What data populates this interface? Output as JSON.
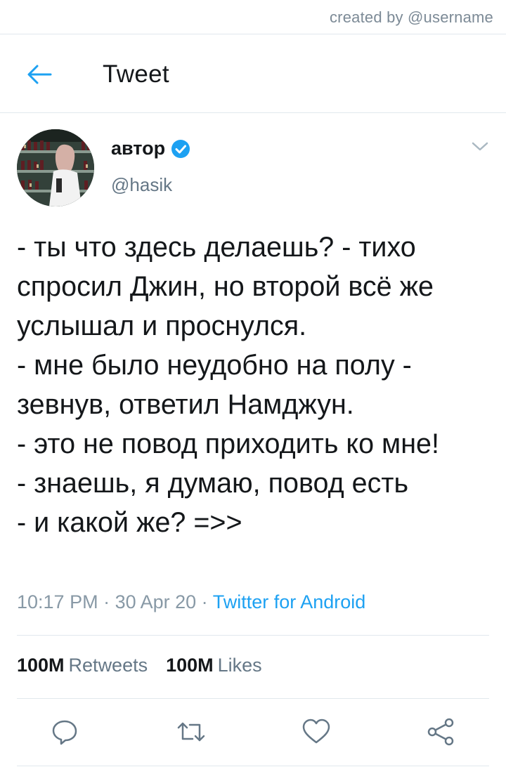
{
  "credit": "created by @username",
  "header": {
    "title": "Tweet"
  },
  "author": {
    "name": "автор",
    "handle": "@hasik"
  },
  "tweet": {
    "text": "- ты что здесь делаешь? - тихо спросил Джин, но второй всё же услышал и проснулся.\n- мне было неудобно на полу - зевнув, ответил Намджун.\n- это не повод приходить ко мне!\n- знаешь, я думаю, повод есть\n- и какой же? =>>",
    "time": "10:17 PM",
    "date": "30 Apr 20",
    "source": "Twitter for Android"
  },
  "stats": {
    "retweets_count": "100M",
    "retweets_label": "Retweets",
    "likes_count": "100M",
    "likes_label": "Likes"
  },
  "icons": {
    "back": "arrow-left-icon",
    "verified": "verified-badge-icon",
    "menu": "chevron-down-icon",
    "reply": "reply-icon",
    "retweet": "retweet-icon",
    "like": "heart-icon",
    "share": "share-icon"
  },
  "colors": {
    "accent": "#1da1f2",
    "text": "#14171a",
    "muted": "#657786",
    "divider": "#e1e8ed"
  }
}
